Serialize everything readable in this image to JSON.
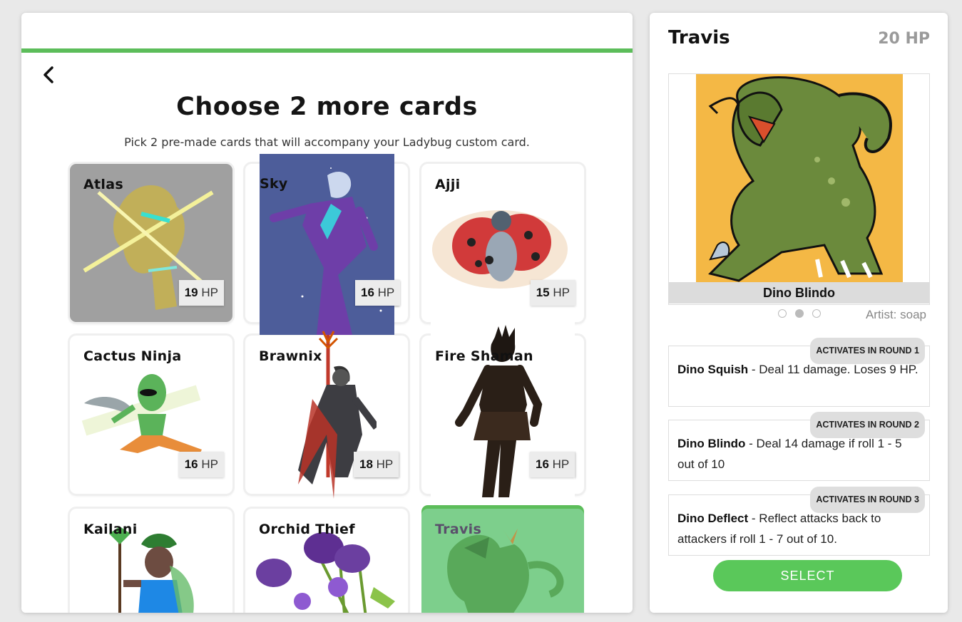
{
  "header": {
    "title": "Choose 2 more cards",
    "subtitle": "Pick 2 pre-made cards that will accompany your Ladybug custom card.",
    "progress_color": "#5cbd5a"
  },
  "cards": [
    {
      "name": "Atlas",
      "hp": "19",
      "unit": "HP"
    },
    {
      "name": "Sky",
      "hp": "16",
      "unit": "HP"
    },
    {
      "name": "Ajji",
      "hp": "15",
      "unit": "HP"
    },
    {
      "name": "Cactus Ninja",
      "hp": "16",
      "unit": "HP"
    },
    {
      "name": "Brawnix",
      "hp": "18",
      "unit": "HP"
    },
    {
      "name": "Fire Shaman",
      "hp": "16",
      "unit": "HP"
    },
    {
      "name": "Kailani"
    },
    {
      "name": "Orchid Thief"
    },
    {
      "name": "Travis",
      "selected": true
    }
  ],
  "detail": {
    "name": "Travis",
    "hp": "20 HP",
    "image_caption": "Dino Blindo",
    "artist": "Artist: soap",
    "abilities": [
      {
        "badge": "ACTIVATES IN ROUND 1",
        "name": "Dino Squish",
        "desc": " - Deal 11 damage. Loses 9 HP."
      },
      {
        "badge": "ACTIVATES IN ROUND 2",
        "name": "Dino Blindo",
        "desc": " - Deal 14 damage if roll 1 - 5 out of 10"
      },
      {
        "badge": "ACTIVATES IN ROUND 3",
        "name": "Dino Deflect",
        "desc": " - Reflect attacks back to attackers if roll 1 - 7 out of 10."
      }
    ],
    "select_label": "SELECT"
  }
}
